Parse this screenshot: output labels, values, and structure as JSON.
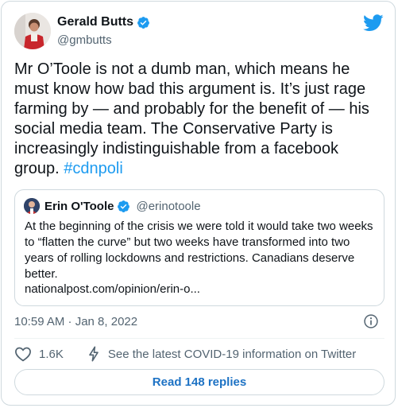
{
  "author": {
    "name": "Gerald Butts",
    "handle": "@gmbutts"
  },
  "tweet": {
    "text": "Mr O’Toole is not a dumb man, which means he must know how bad this argument is. It’s just rage farming by — and probably for the benefit of — his social media team. The Conservative Party is increasingly indistinguishable from a facebook group. ",
    "hashtag": "#cdnpoli"
  },
  "quote": {
    "name": "Erin O'Toole",
    "handle": "@erinotoole",
    "text": "At the beginning of the crisis we were told it would take two weeks to “flatten the curve” but two weeks have transformed into two years of rolling lockdowns and restrictions. Canadians deserve better.",
    "link": "nationalpost.com/opinion/erin-o..."
  },
  "meta": {
    "timestamp": "10:59 AM · Jan 8, 2022"
  },
  "actions": {
    "like_count": "1.6K",
    "covid_text": "See the latest COVID-19 information on Twitter"
  },
  "read_replies_label": "Read 148 replies",
  "colors": {
    "accent": "#1d9bf0",
    "secondary_text": "#536471",
    "border": "#cfd9de"
  },
  "icons": [
    "verified-badge-icon",
    "twitter-bird-icon",
    "info-icon",
    "heart-icon",
    "lightning-icon"
  ]
}
